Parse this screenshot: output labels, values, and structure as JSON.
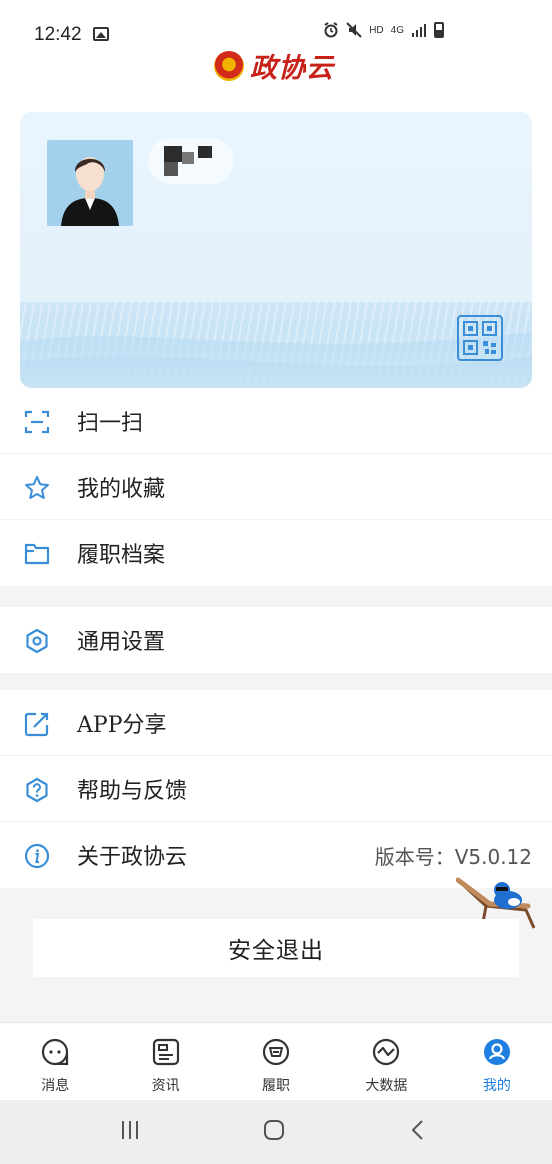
{
  "status_bar": {
    "time": "12:42",
    "network": "HD",
    "signal": "4G"
  },
  "header": {
    "logo_text": "政协云"
  },
  "profile_card": {
    "name": ""
  },
  "menu_groups": [
    [
      {
        "label": "扫一扫",
        "icon": "scan-icon"
      },
      {
        "label": "我的收藏",
        "icon": "star-icon"
      },
      {
        "label": "履职档案",
        "icon": "folder-icon"
      }
    ],
    [
      {
        "label": "通用设置",
        "icon": "settings-icon"
      }
    ],
    [
      {
        "label": "APP分享",
        "icon": "share-icon"
      },
      {
        "label": "帮助与反馈",
        "icon": "help-icon"
      },
      {
        "label": "关于政协云",
        "icon": "info-icon",
        "value": "版本号：V5.0.12"
      }
    ]
  ],
  "logout_label": "安全退出",
  "tabs": [
    {
      "label": "消息",
      "icon": "message-icon",
      "active": false
    },
    {
      "label": "资讯",
      "icon": "news-icon",
      "active": false
    },
    {
      "label": "履职",
      "icon": "duty-icon",
      "active": false
    },
    {
      "label": "大数据",
      "icon": "data-icon",
      "active": false
    },
    {
      "label": "我的",
      "icon": "profile-icon",
      "active": true
    }
  ],
  "colors": {
    "accent": "#1f7fe0",
    "icon_blue": "#3a8ed8",
    "logo_red": "#c8211a"
  }
}
